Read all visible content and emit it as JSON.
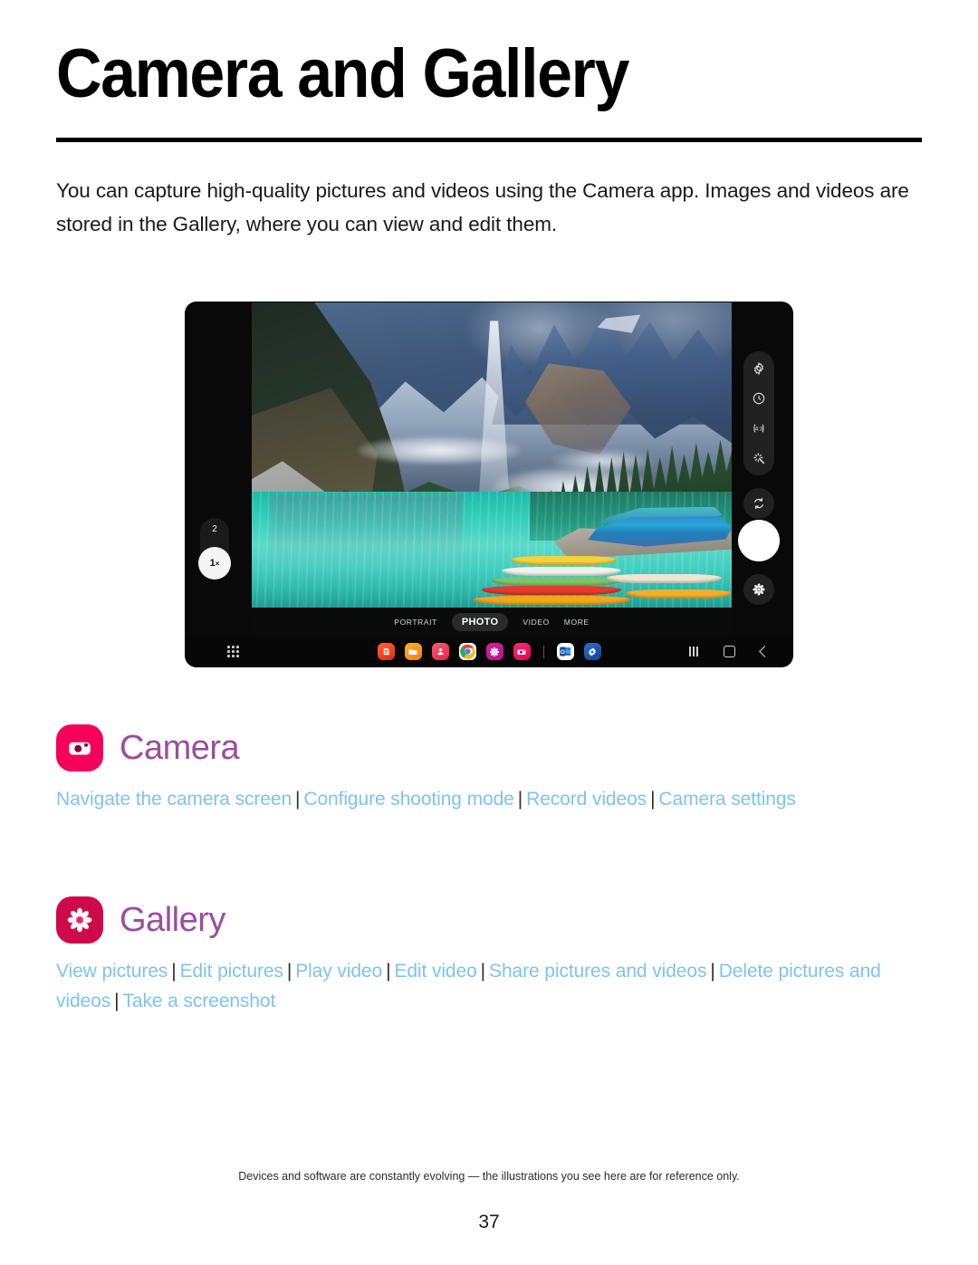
{
  "page": {
    "title": "Camera and Gallery",
    "intro": "You can capture high-quality pictures and videos using the Camera app. Images and videos are stored in the Gallery, where you can view and edit them.",
    "footnote": "Devices and software are constantly evolving — the illustrations you see here are for reference only.",
    "page_number": "37"
  },
  "colors": {
    "link": "#7ec3f0",
    "heading": "#9b4d9e",
    "camera_badge": "#f5005a",
    "gallery_badge": "#cf0a4b",
    "rule": "#000000"
  },
  "illustration": {
    "device": "samsung-tablet-camera-app",
    "scene": "Moraine Lake with canoes at dock and mountain range",
    "camera_ui": {
      "modes": [
        {
          "label": "PORTRAIT",
          "active": false
        },
        {
          "label": "PHOTO",
          "active": true
        },
        {
          "label": "VIDEO",
          "active": false
        },
        {
          "label": "MORE",
          "active": false
        }
      ],
      "zoom": {
        "secondary": "2",
        "active": "1",
        "active_suffix": "×"
      },
      "side_controls": [
        {
          "name": "settings-icon",
          "label": "Settings"
        },
        {
          "name": "timer-icon",
          "label": "Timer"
        },
        {
          "name": "aspect-ratio-icon",
          "label": "Aspect ratio"
        },
        {
          "name": "effects-icon",
          "label": "Effects"
        }
      ],
      "flip_label": "Switch cameras",
      "shutter_label": "Capture",
      "thumbnail_label": "Gallery"
    },
    "taskbar": {
      "apps_button": "All apps",
      "apps": [
        {
          "name": "samsung-notes-icon",
          "label": "Samsung Notes"
        },
        {
          "name": "my-files-icon",
          "label": "My Files"
        },
        {
          "name": "contacts-icon",
          "label": "Contacts"
        },
        {
          "name": "chrome-icon",
          "label": "Chrome"
        },
        {
          "name": "gallery-icon",
          "label": "Gallery"
        },
        {
          "name": "camera-icon",
          "label": "Camera"
        },
        {
          "name": "outlook-icon",
          "label": "Outlook"
        },
        {
          "name": "settings-icon",
          "label": "Settings"
        }
      ],
      "nav": [
        {
          "name": "recents-button",
          "label": "Recents"
        },
        {
          "name": "home-button",
          "label": "Home"
        },
        {
          "name": "back-button",
          "label": "Back"
        }
      ]
    }
  },
  "sections": [
    {
      "id": "camera",
      "name": "Camera",
      "icon": "camera-app-icon",
      "links": [
        "Navigate the camera screen",
        "Configure shooting mode",
        "Record videos",
        "Camera settings"
      ]
    },
    {
      "id": "gallery",
      "name": "Gallery",
      "icon": "gallery-app-icon",
      "links": [
        "View pictures",
        "Edit pictures",
        "Play video",
        "Edit video",
        "Share pictures and videos",
        "Delete pictures and videos",
        "Take a screenshot"
      ]
    }
  ]
}
